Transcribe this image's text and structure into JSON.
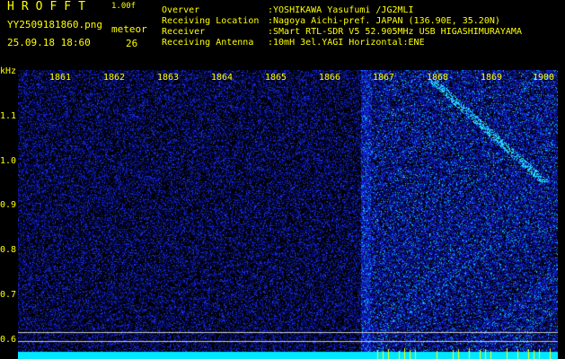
{
  "header": {
    "app_name": "HROFFT",
    "version": "1.00f",
    "filename": "YY2509181860.png",
    "datetime": "25.09.18 18:60",
    "meteor_label": "meteor",
    "meteor_count": "26"
  },
  "info": [
    {
      "label": "Overver",
      "value": ":YOSHIKAWA Yasufumi /JG2MLI"
    },
    {
      "label": "Receiving Location",
      "value": ":Nagoya Aichi-pref. JAPAN (136.90E, 35.20N)"
    },
    {
      "label": "Receiver",
      "value": ":SMart RTL-SDR V5 52.905MHz USB HIGASHIMURAYAMA"
    },
    {
      "label": "Receiving Antenna",
      "value": ":10mH 3el.YAGI Horizontal:ENE"
    }
  ],
  "axis": {
    "y_unit": "kHz",
    "y_ticks": [
      "1.1",
      "1.0",
      "0.9",
      "0.8",
      "0.7",
      "0.6"
    ],
    "x_ticks": [
      "1861",
      "1862",
      "1863",
      "1864",
      "1865",
      "1866",
      "1867",
      "1868",
      "1869",
      "1900"
    ]
  },
  "colors": {
    "label_yellow": "#ffff00",
    "noise_blue": "#1a2acc",
    "signal_cyan": "#00e8ff"
  }
}
